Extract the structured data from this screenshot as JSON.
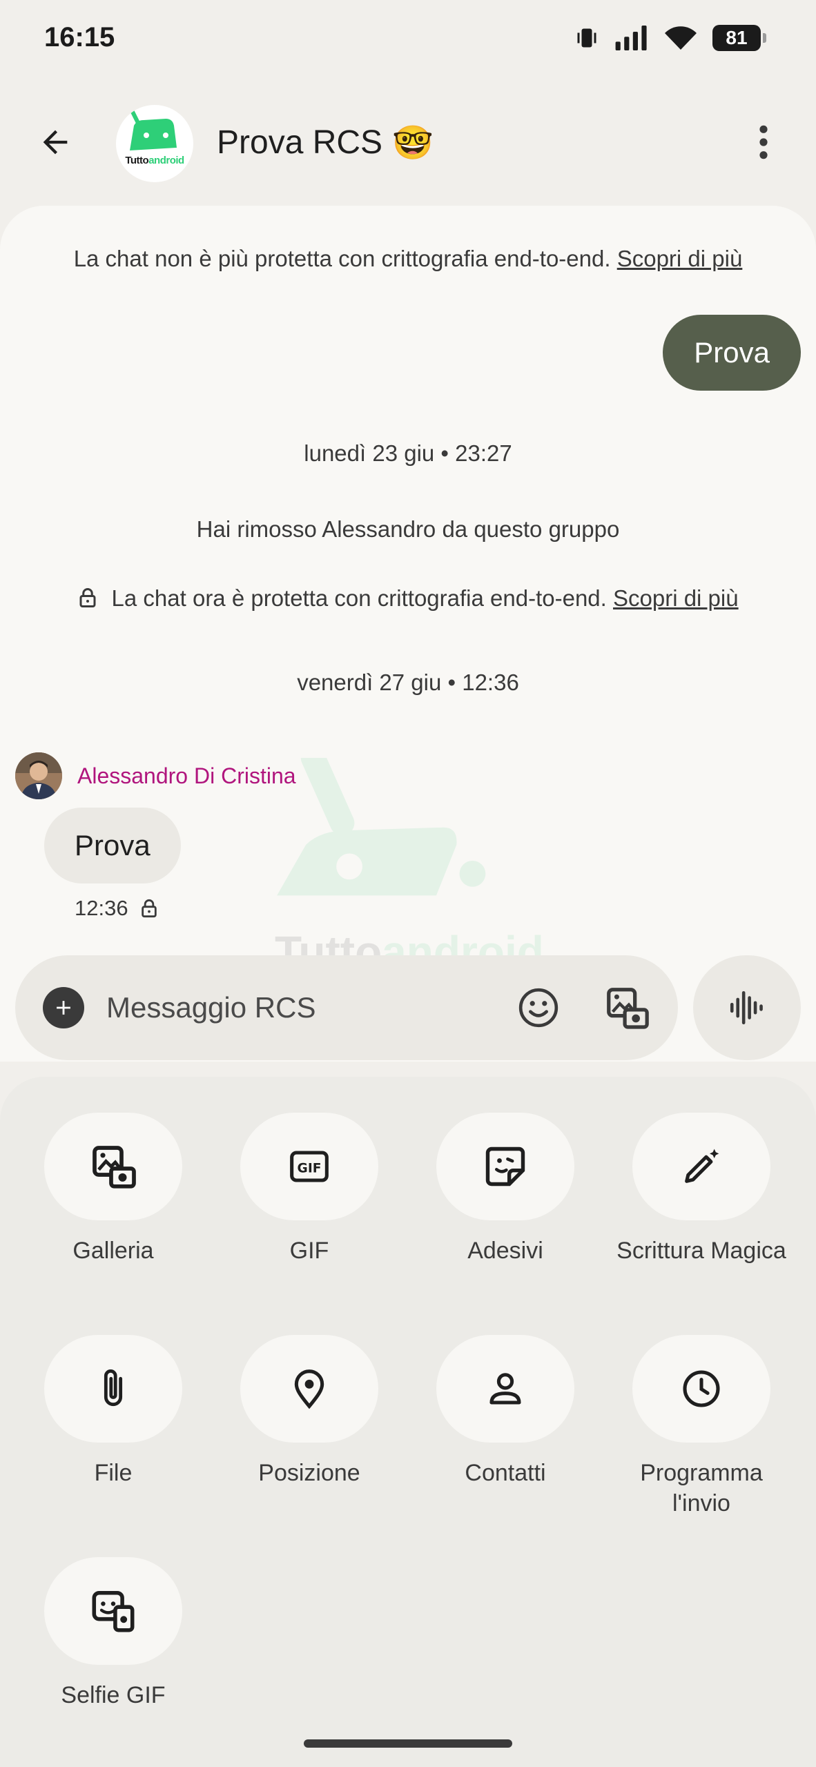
{
  "status_bar": {
    "time": "16:15",
    "battery": "81",
    "icons": [
      "vibrate-icon",
      "signal-icon",
      "wifi-icon",
      "battery-icon"
    ]
  },
  "header": {
    "title": "Prova RCS",
    "title_emoji": "🤓",
    "logo_text_dark": "Tutto",
    "logo_text_green": "android",
    "brand_green": "#2ecf78"
  },
  "conversation": {
    "notice_unencrypted": "La chat non è più protetta con crittografia end-to-end.",
    "notice_unencrypted_link": "Scopri di più",
    "outgoing_message": "Prova",
    "date_1": "lunedì 23 giu • 23:27",
    "removed_notice": "Hai rimosso Alessandro da questo gruppo",
    "notice_encrypted": "La chat ora è protetta con crittografia end-to-end.",
    "notice_encrypted_link": "Scopri di più",
    "date_2": "venerdì 27 giu • 12:36",
    "sender_name": "Alessandro Di Cristina",
    "sender_color": "#b0157d",
    "incoming_message": "Prova",
    "incoming_time": "12:36",
    "outgoing_bubble_color": "#565f4c",
    "watermark_dark": "Tutto",
    "watermark_green": "android"
  },
  "compose": {
    "placeholder": "Messaggio RCS"
  },
  "attach_sheet": {
    "items": [
      {
        "label": "Galleria",
        "icon": "gallery-icon"
      },
      {
        "label": "GIF",
        "icon": "gif-icon"
      },
      {
        "label": "Adesivi",
        "icon": "sticker-icon"
      },
      {
        "label": "Scrittura Magica",
        "icon": "magic-pen-icon"
      },
      {
        "label": "File",
        "icon": "paperclip-icon"
      },
      {
        "label": "Posizione",
        "icon": "location-pin-icon"
      },
      {
        "label": "Contatti",
        "icon": "contact-icon"
      },
      {
        "label": "Programma l'invio",
        "icon": "clock-icon"
      },
      {
        "label": "Selfie GIF",
        "icon": "selfie-gif-icon"
      }
    ]
  }
}
